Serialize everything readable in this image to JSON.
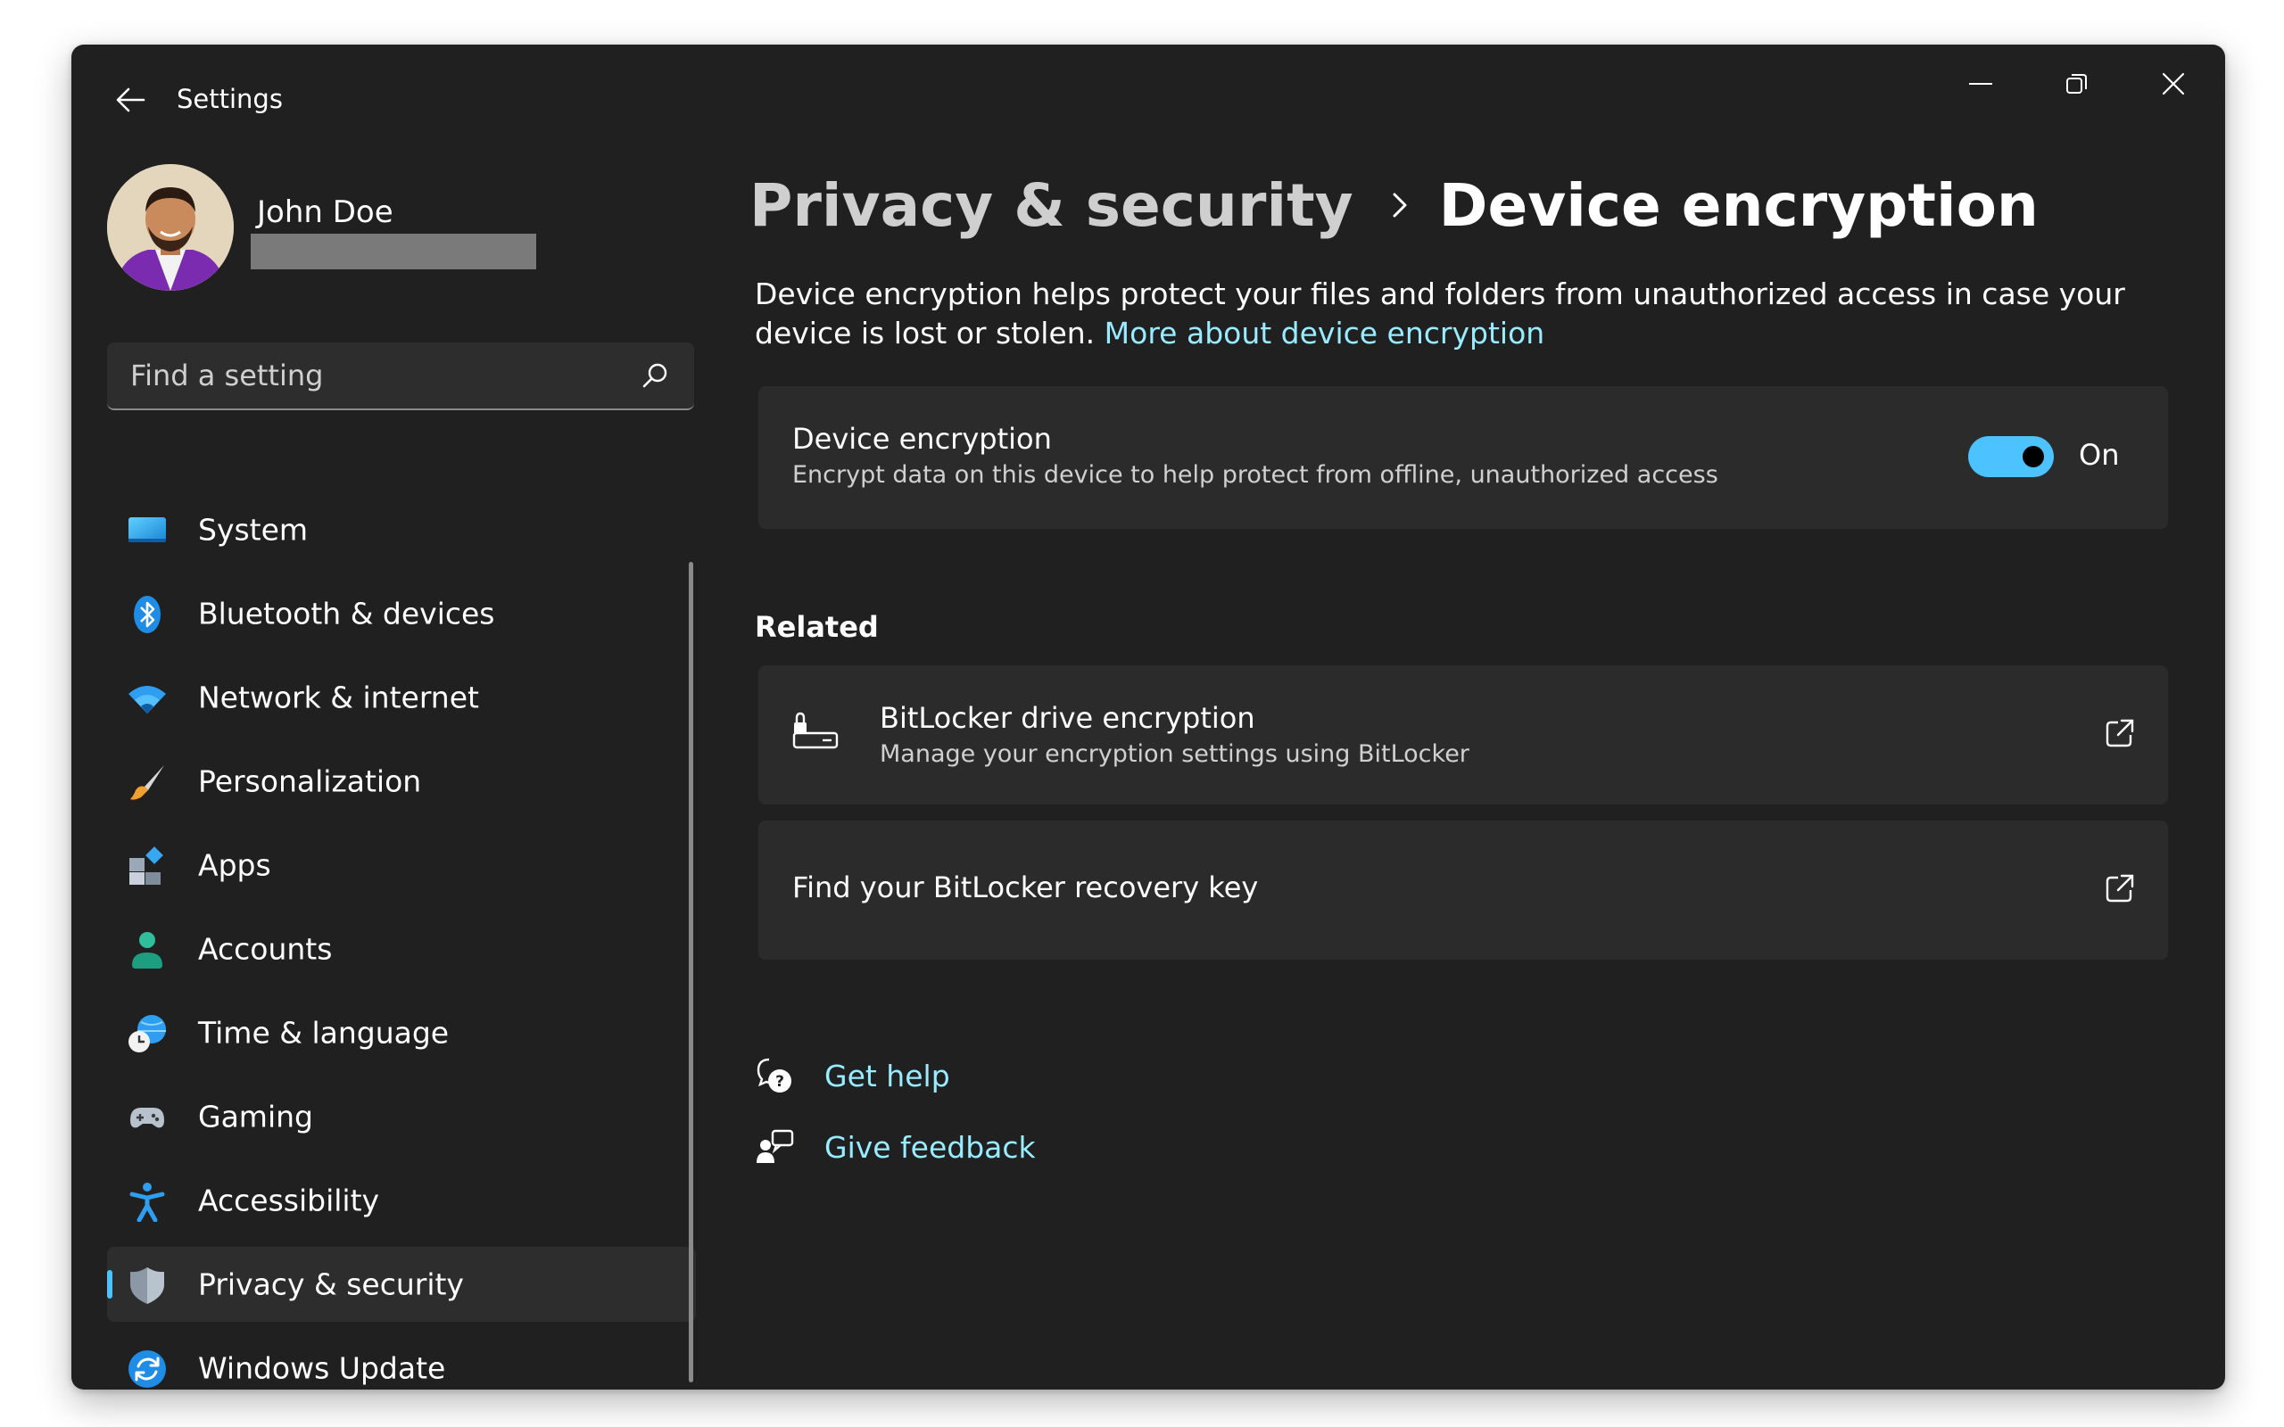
{
  "window": {
    "title": "Settings"
  },
  "profile": {
    "name": "John Doe"
  },
  "search": {
    "placeholder": "Find a setting"
  },
  "sidebar": {
    "items": [
      {
        "label": "System",
        "icon": "system-icon"
      },
      {
        "label": "Bluetooth & devices",
        "icon": "bluetooth-icon"
      },
      {
        "label": "Network & internet",
        "icon": "wifi-icon"
      },
      {
        "label": "Personalization",
        "icon": "brush-icon"
      },
      {
        "label": "Apps",
        "icon": "apps-icon"
      },
      {
        "label": "Accounts",
        "icon": "accounts-icon"
      },
      {
        "label": "Time & language",
        "icon": "time-language-icon"
      },
      {
        "label": "Gaming",
        "icon": "gamepad-icon"
      },
      {
        "label": "Accessibility",
        "icon": "accessibility-icon"
      },
      {
        "label": "Privacy & security",
        "icon": "shield-icon",
        "active": true
      },
      {
        "label": "Windows Update",
        "icon": "update-icon"
      }
    ]
  },
  "breadcrumb": {
    "parent": "Privacy & security",
    "current": "Device encryption"
  },
  "description": {
    "text": "Device encryption helps protect your files and folders from unauthorized access in case your device is lost or stolen.",
    "link": "More about device encryption"
  },
  "encryption_card": {
    "title": "Device encryption",
    "subtitle": "Encrypt data on this device to help protect from offline, unauthorized access",
    "toggle_state": "On",
    "toggle_on": true
  },
  "related": {
    "title": "Related",
    "bitlocker": {
      "title": "BitLocker drive encryption",
      "subtitle": "Manage your encryption settings using BitLocker"
    },
    "recovery": {
      "title": "Find your BitLocker recovery key"
    }
  },
  "help": {
    "get_help": "Get help",
    "give_feedback": "Give feedback"
  },
  "colors": {
    "accent": "#4cc2ff",
    "link": "#99ebff",
    "background": "#202020",
    "card": "#2b2b2b"
  }
}
